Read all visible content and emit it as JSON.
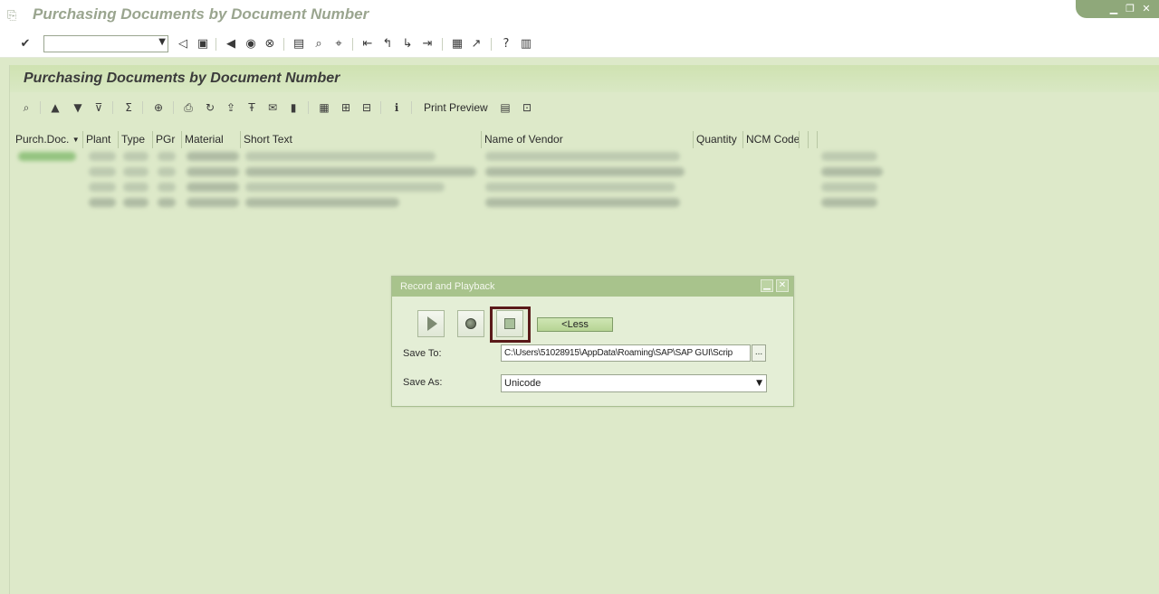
{
  "window": {
    "title": "Purchasing Documents by Document Number",
    "controls": [
      "minimize",
      "maximize",
      "close"
    ]
  },
  "std_toolbar": {
    "command_field_value": "",
    "icons": [
      "enter-icon",
      "back-icon",
      "save-icon",
      "back-nav-icon",
      "exit-icon",
      "cancel-icon",
      "print-icon",
      "find-icon",
      "find-next-icon",
      "first-page-icon",
      "previous-page-icon",
      "next-page-icon",
      "last-page-icon",
      "create-session-icon",
      "shortcut-icon",
      "help-icon",
      "layout-icon"
    ]
  },
  "header": {
    "title": "Purchasing Documents by Document Number"
  },
  "alv_toolbar": {
    "print_preview_label": "Print Preview"
  },
  "grid": {
    "columns": [
      "Purch.Doc.",
      "Plant",
      "Type",
      "PGr",
      "Material",
      "Short Text",
      "Name of Vendor",
      "Quantity",
      "NCM Code"
    ]
  },
  "dialog": {
    "title": "Record and Playback",
    "less_label": "<Less",
    "save_to_label": "Save To:",
    "save_to_value": "C:\\Users\\51028915\\AppData\\Roaming\\SAP\\SAP GUI\\Scrip",
    "browse_label": "...",
    "save_as_label": "Save As:",
    "save_as_value": "Unicode"
  }
}
